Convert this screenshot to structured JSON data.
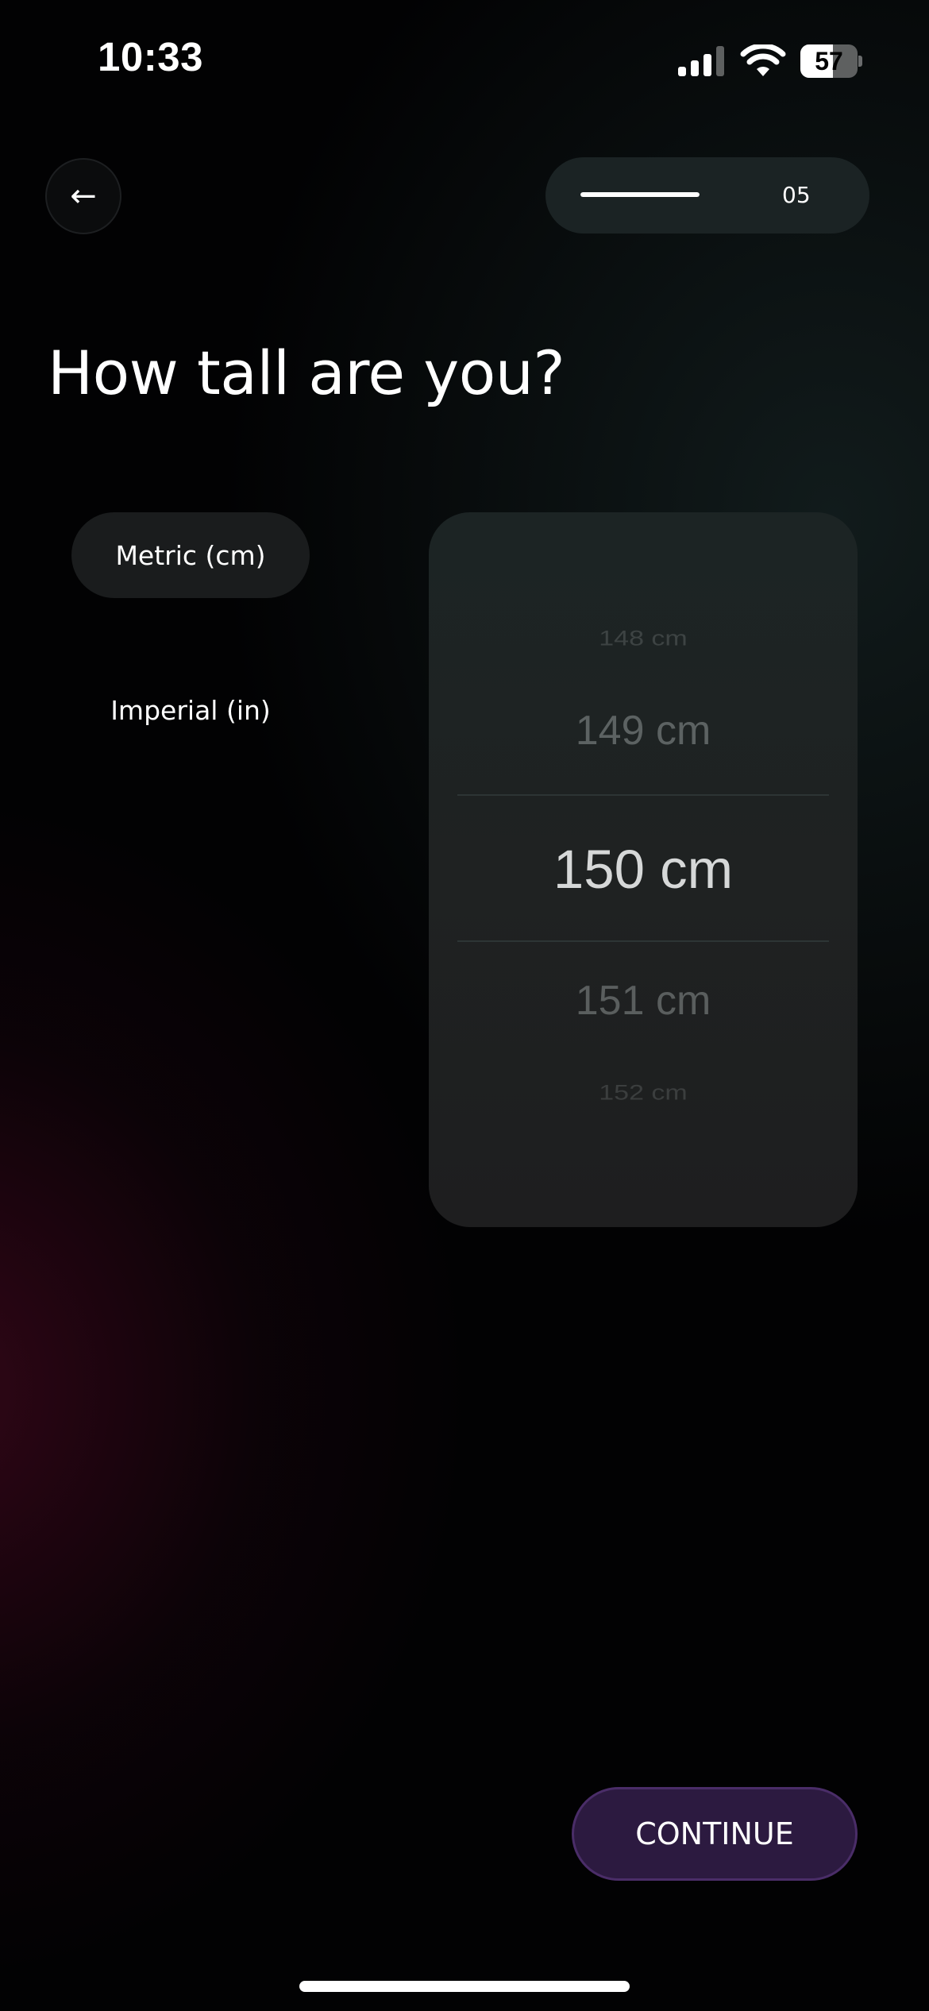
{
  "status_bar": {
    "time": "10:33",
    "battery_level": "57",
    "battery_fraction": 0.57,
    "icons": [
      "signal-icon",
      "wifi-icon",
      "battery-icon"
    ]
  },
  "header": {
    "back_icon": "arrow-left-icon",
    "back_glyph": "←",
    "progress_fraction": 1.0,
    "step": "05"
  },
  "title": "How tall are you?",
  "units": {
    "selected": "metric",
    "options": [
      {
        "id": "metric",
        "label": "Metric (cm)"
      },
      {
        "id": "imperial",
        "label": "Imperial (in)"
      }
    ]
  },
  "picker": {
    "selected": "150 cm",
    "options": [
      "148 cm",
      "149 cm",
      "150 cm",
      "151 cm",
      "152 cm"
    ]
  },
  "continue_label": "CONTINUE",
  "colors": {
    "accent": "#2c1a40",
    "accent_border": "#4a2d68",
    "background": "#020203"
  }
}
